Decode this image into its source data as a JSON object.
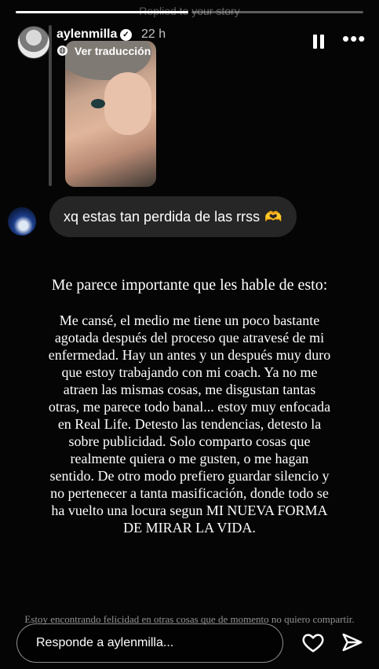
{
  "story": {
    "replied_label": "Replied to your story",
    "progress": [
      1.0,
      0.0
    ],
    "user": {
      "username": "aylenmilla",
      "verified": true,
      "time_ago": "22 h",
      "translate_label": "Ver traducción"
    },
    "icons": {
      "pause": "pause-icon",
      "more": "more-icon",
      "globe": "globe-icon",
      "heart": "heart-icon",
      "send": "send-icon"
    }
  },
  "message": {
    "text": "xq estas tan perdida de las rrss",
    "emoji": "🫶"
  },
  "content": {
    "title": "Me parece importante que les hable de esto:",
    "body": "Me cansé, el medio me tiene un poco bastante agotada después del proceso que atravesé de mi enfermedad. Hay un antes y un después muy duro que estoy trabajando con mi coach. Ya no me atraen las mismas cosas, me disgustan tantas otras, me parece todo banal... estoy muy enfocada en Real Life. Detesto las tendencias, detesto la sobre publicidad. Solo comparto cosas que realmente quiera o me gusten, o me hagan sentido. De otro modo prefiero guardar silencio y no pertenecer a tanta masificación, donde todo se ha vuelto una locura segun MI NUEVA FORMA DE MIRAR LA VIDA.",
    "footnote": "Estoy encontrando felicidad en otras cosas que de momento no quiero compartir."
  },
  "reply": {
    "placeholder": "Responde a aylenmilla..."
  }
}
